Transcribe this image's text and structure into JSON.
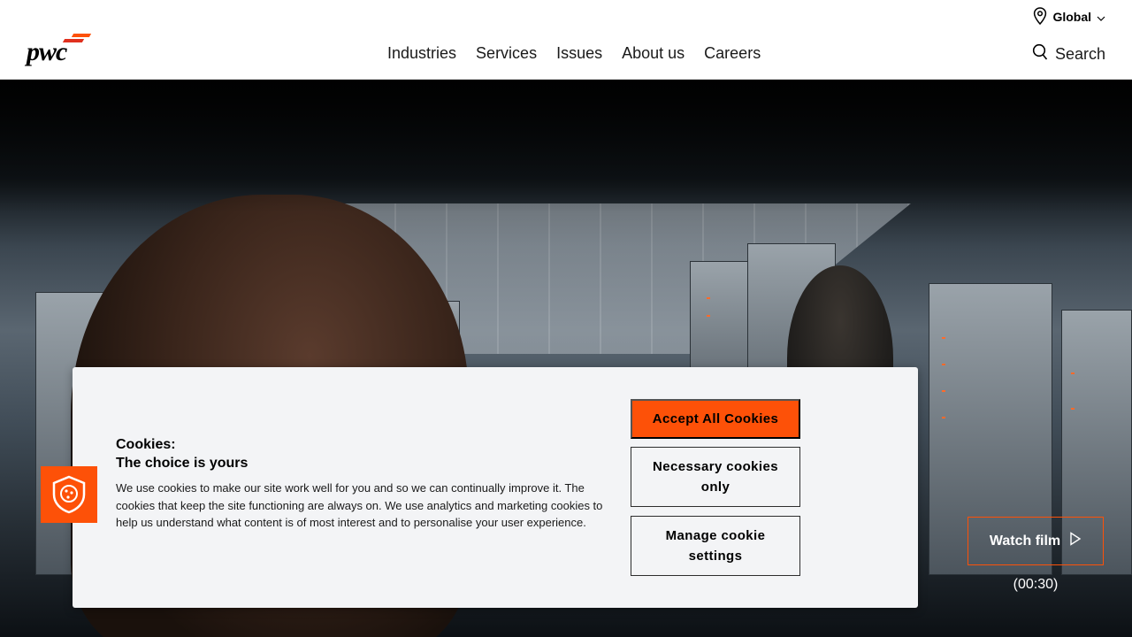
{
  "header": {
    "logo_text": "pwc",
    "locale": {
      "label": "Global",
      "icon": "location-pin-icon"
    },
    "nav": [
      {
        "label": "Industries"
      },
      {
        "label": "Services"
      },
      {
        "label": "Issues"
      },
      {
        "label": "About us"
      },
      {
        "label": "Careers"
      }
    ],
    "search": {
      "label": "Search",
      "icon": "search-icon"
    }
  },
  "hero": {
    "watch_label": "Watch film",
    "watch_icon": "play-icon",
    "duration": "(00:30)"
  },
  "cookie_banner": {
    "title_line1": "Cookies:",
    "title_line2": "The choice is yours",
    "body": "We use cookies to make our site work well for you and so we can continually improve it. The cookies that keep the site functioning are always on. We use analytics and marketing cookies to help us understand what content is of most interest and to personalise your user experience.",
    "accept_label": "Accept All Cookies",
    "necessary_label": "Necessary cookies only",
    "manage_label": "Manage cookie settings",
    "badge_icon": "cookie-shield-icon"
  },
  "colors": {
    "accent": "#fd5108",
    "banner_bg": "#f3f4f6",
    "text": "#000000"
  }
}
